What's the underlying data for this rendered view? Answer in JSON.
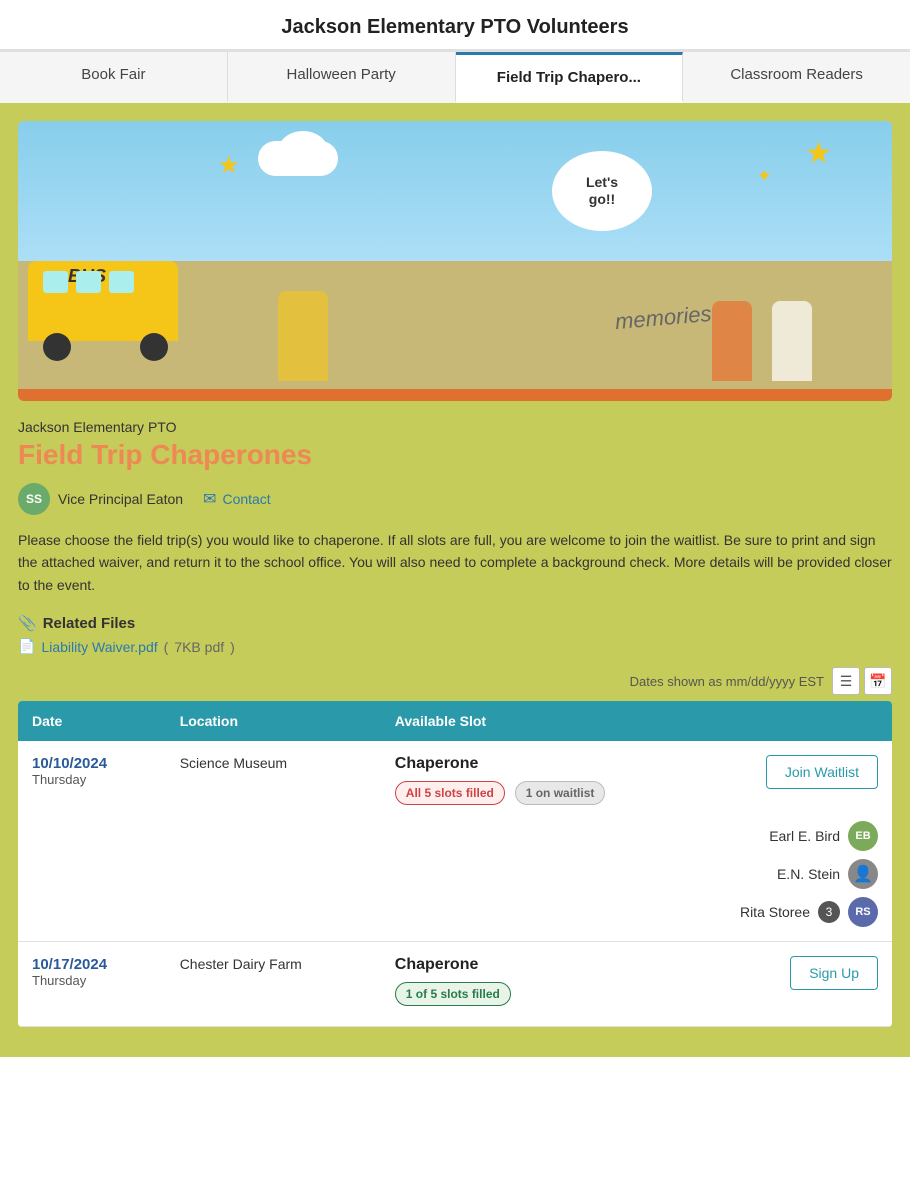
{
  "header": {
    "title": "Jackson Elementary PTO Volunteers"
  },
  "tabs": [
    {
      "id": "book-fair",
      "label": "Book Fair",
      "active": false
    },
    {
      "id": "halloween-party",
      "label": "Halloween Party",
      "active": false
    },
    {
      "id": "field-trip",
      "label": "Field Trip Chapero...",
      "active": true
    },
    {
      "id": "classroom-readers",
      "label": "Classroom Readers",
      "active": false
    }
  ],
  "section": {
    "org": "Jackson Elementary PTO",
    "title": "Field Trip Chaperones",
    "coordinator": {
      "initials": "SS",
      "name": "Vice Principal Eaton",
      "contact_label": "Contact"
    },
    "description": "Please choose the field trip(s) you would like to chaperone. If all slots are full, you are welcome to join the waitlist. Be sure to print and sign the attached waiver, and return it to the school office. You will also need to complete a background check. More details will be provided closer to the event.",
    "related_files_title": "Related Files",
    "files": [
      {
        "name": "Liability Waiver.pdf",
        "size": "7KB pdf"
      }
    ]
  },
  "table": {
    "dates_label": "Dates shown as mm/dd/yyyy EST",
    "columns": [
      "Date",
      "Location",
      "Available Slot"
    ],
    "rows": [
      {
        "date": "10/10/2024",
        "day": "Thursday",
        "location": "Science Museum",
        "slot_name": "Chaperone",
        "badges": [
          {
            "label": "All 5 slots filled",
            "type": "red"
          },
          {
            "label": "1 on waitlist",
            "type": "gray"
          }
        ],
        "action": "Join Waitlist",
        "signups": [
          {
            "name": "Earl E. Bird",
            "initials": "EB",
            "color": "#7aaa5a",
            "extra": null
          },
          {
            "name": "E.N. Stein",
            "initials": null,
            "avatar_color": "#888",
            "extra": null,
            "photo": true
          },
          {
            "name": "Rita Storee",
            "initials": "RS",
            "color": "#5a6aaa",
            "extra": "3"
          }
        ]
      },
      {
        "date": "10/17/2024",
        "day": "Thursday",
        "location": "Chester Dairy Farm",
        "slot_name": "Chaperone",
        "badges": [
          {
            "label": "1 of 5 slots filled",
            "type": "blue"
          }
        ],
        "action": "Sign Up",
        "signups": []
      }
    ]
  }
}
